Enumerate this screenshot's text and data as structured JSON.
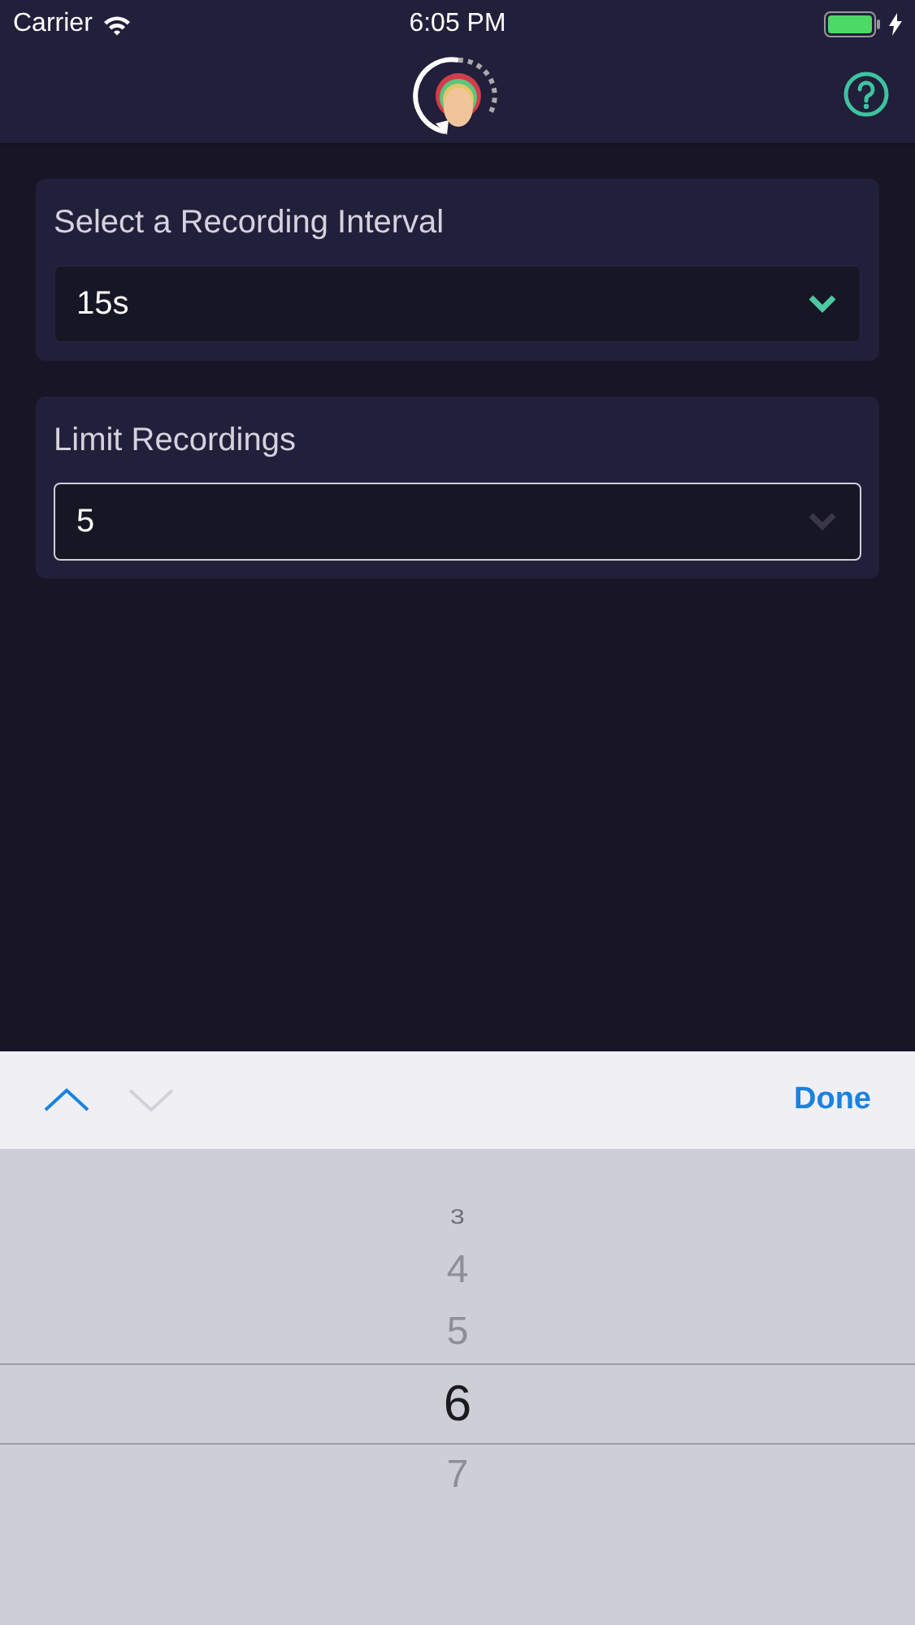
{
  "status_bar": {
    "carrier": "Carrier",
    "time": "6:05 PM"
  },
  "fields": [
    {
      "label": "Select a Recording Interval",
      "value": "15s",
      "focused": false
    },
    {
      "label": "Limit Recordings",
      "value": "5",
      "focused": true
    }
  ],
  "toolbar": {
    "previous_enabled": true,
    "next_enabled": false,
    "done": "Done"
  },
  "picker": [
    {
      "label": "3",
      "selected": false
    },
    {
      "label": "4",
      "selected": false
    },
    {
      "label": "5",
      "selected": false
    },
    {
      "label": "6",
      "selected": true
    },
    {
      "label": "7",
      "selected": false
    }
  ]
}
